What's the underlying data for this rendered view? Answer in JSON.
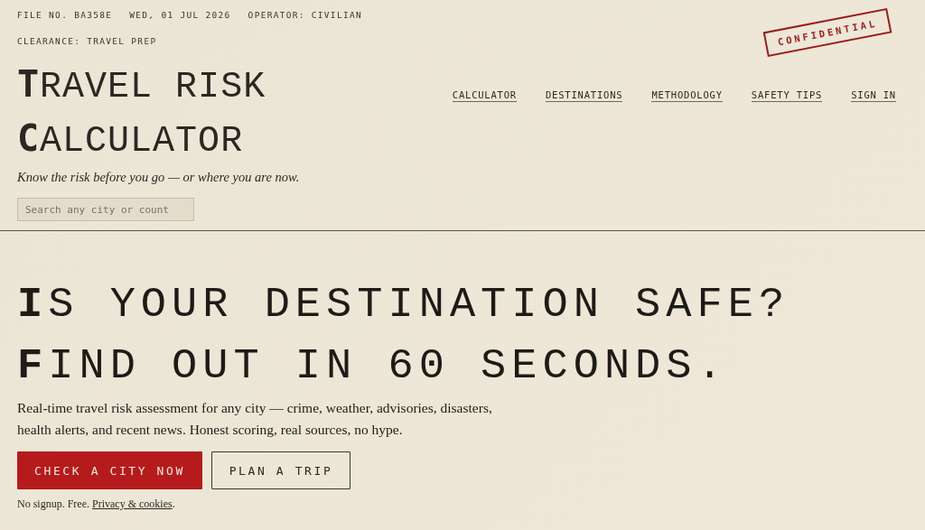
{
  "header": {
    "meta": [
      "FILE NO. BA358E",
      "WED, 01 JUL 2026",
      "OPERATOR: CIVILIAN"
    ],
    "clearance": "CLEARANCE: TRAVEL PREP",
    "title_lines": [
      "TRAVEL RISK",
      "CALCULATOR"
    ],
    "tagline": "Know the risk before you go — or where you are now.",
    "search": {
      "placeholder": "Search any city or count"
    },
    "stamp": "CONFIDENTIAL",
    "nav": [
      "CALCULATOR",
      "DESTINATIONS",
      "METHODOLOGY",
      "SAFETY TIPS",
      "SIGN IN"
    ]
  },
  "hero": {
    "headline_lines": [
      "IS YOUR DESTINATION SAFE?",
      "FIND OUT IN 60 SECONDS."
    ],
    "description": "Real-time travel risk assessment for any city — crime, weather, advisories, disasters, health alerts, and recent news. Honest scoring, real sources, no hype.",
    "buttons": [
      {
        "label": "CHECK A CITY NOW",
        "kind": "primary"
      },
      {
        "label": "PLAN A TRIP",
        "kind": "secondary"
      }
    ],
    "note": "No signup. Free.",
    "note_link": "Privacy & cookies",
    "note_end": "."
  }
}
